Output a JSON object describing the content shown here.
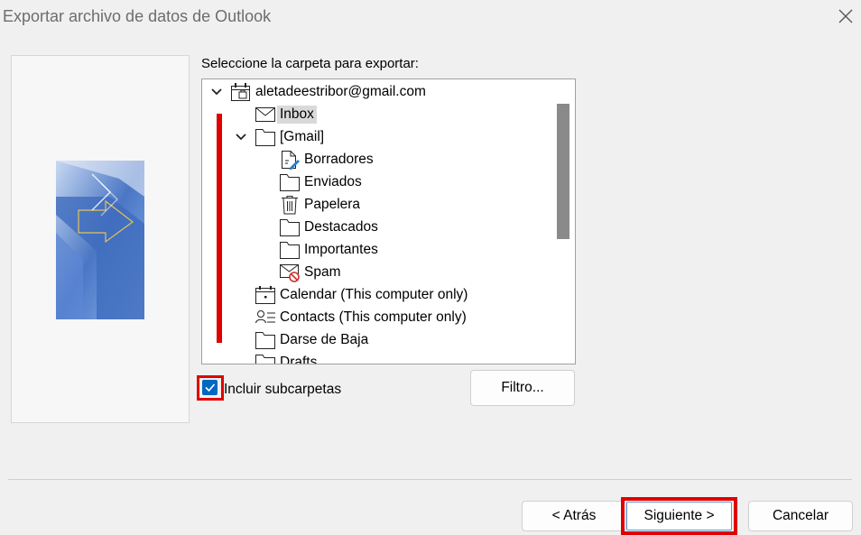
{
  "window": {
    "title": "Exportar archivo de datos de Outlook"
  },
  "prompt": "Seleccione la carpeta para exportar:",
  "tree": {
    "items": [
      {
        "label": "aletadeestribor@gmail.com",
        "icon": "account-icon",
        "expanded": true
      },
      {
        "label": "Inbox",
        "icon": "mail-icon",
        "selected": true
      },
      {
        "label": "[Gmail]",
        "icon": "folder-icon",
        "expanded": true
      },
      {
        "label": "Borradores",
        "icon": "drafts-icon"
      },
      {
        "label": "Enviados",
        "icon": "folder-icon"
      },
      {
        "label": "Papelera",
        "icon": "trash-icon"
      },
      {
        "label": "Destacados",
        "icon": "folder-icon"
      },
      {
        "label": "Importantes",
        "icon": "folder-icon"
      },
      {
        "label": "Spam",
        "icon": "spam-icon"
      },
      {
        "label": "Calendar (This computer only)",
        "icon": "calendar-icon"
      },
      {
        "label": "Contacts (This computer only)",
        "icon": "contacts-icon"
      },
      {
        "label": "Darse de Baja",
        "icon": "folder-icon"
      },
      {
        "label": "Drafts",
        "icon": "folder-icon"
      }
    ]
  },
  "include_subfolders": {
    "label": "Incluir subcarpetas",
    "checked": true
  },
  "buttons": {
    "filter": "Filtro...",
    "back": "< Atrás",
    "next": "Siguiente >",
    "cancel": "Cancelar"
  },
  "colors": {
    "accent": "#0067c0",
    "highlight": "#e00000",
    "selection": "#d9d9d9"
  }
}
